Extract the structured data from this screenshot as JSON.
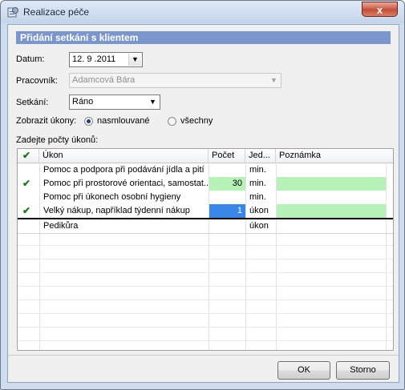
{
  "window": {
    "title": "Realizace péče",
    "close_label": "x"
  },
  "section": {
    "header": "Přidání setkání s klientem"
  },
  "form": {
    "date_label": "Datum:",
    "date_value": "12. 9 .2011",
    "worker_label": "Pracovník:",
    "worker_value": "Adamcová Bára",
    "meeting_label": "Setkání:",
    "meeting_value": "Ráno",
    "show_label": "Zobrazit úkony:",
    "radio_contracted": "nasmlouvané",
    "radio_all": "všechny",
    "selected_radio": "nasmlouvané",
    "counts_label": "Zadejte počty úkonů:"
  },
  "grid": {
    "columns": [
      "✔",
      "Úkon",
      "Počet",
      "Jed...",
      "Poznámka"
    ],
    "rows": [
      {
        "check": "",
        "task": "Pomoc a podpora při podávání jídla a pití",
        "count": "",
        "unit": "min.",
        "note": ""
      },
      {
        "check": "✔",
        "task": "Pomoc při prostorové orientaci, samostat...",
        "count": "30",
        "unit": "min.",
        "note": ""
      },
      {
        "check": "",
        "task": "Pomoc při úkonech osobní hygieny",
        "count": "",
        "unit": "min.",
        "note": ""
      },
      {
        "check": "✔",
        "task": "Velký nákup, například týdenní nákup",
        "count": "1",
        "unit": "úkon",
        "note": ""
      },
      {
        "check": "",
        "task": "Pedikůra",
        "count": "",
        "unit": "úkon",
        "note": ""
      }
    ]
  },
  "buttons": {
    "ok": "OK",
    "cancel": "Storno"
  },
  "colors": {
    "header_bar": "#7b96cc",
    "active_cell": "#b7f2b8",
    "selected_cell": "#3a85e8",
    "check": "#1a7a1a"
  }
}
